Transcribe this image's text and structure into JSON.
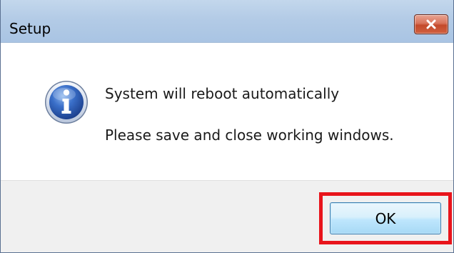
{
  "window": {
    "title": "Setup",
    "close_icon": "close-icon"
  },
  "message": {
    "icon": "info-icon",
    "line1": "System will reboot automatically",
    "line2": "Please save and close working windows."
  },
  "footer": {
    "ok_label": "OK"
  },
  "colors": {
    "titlebar": "#b3cbe6",
    "close_button": "#c44a2b",
    "highlight": "#e8141b",
    "ok_button_border": "#3c7fb1",
    "footer": "#f0f0f0"
  }
}
